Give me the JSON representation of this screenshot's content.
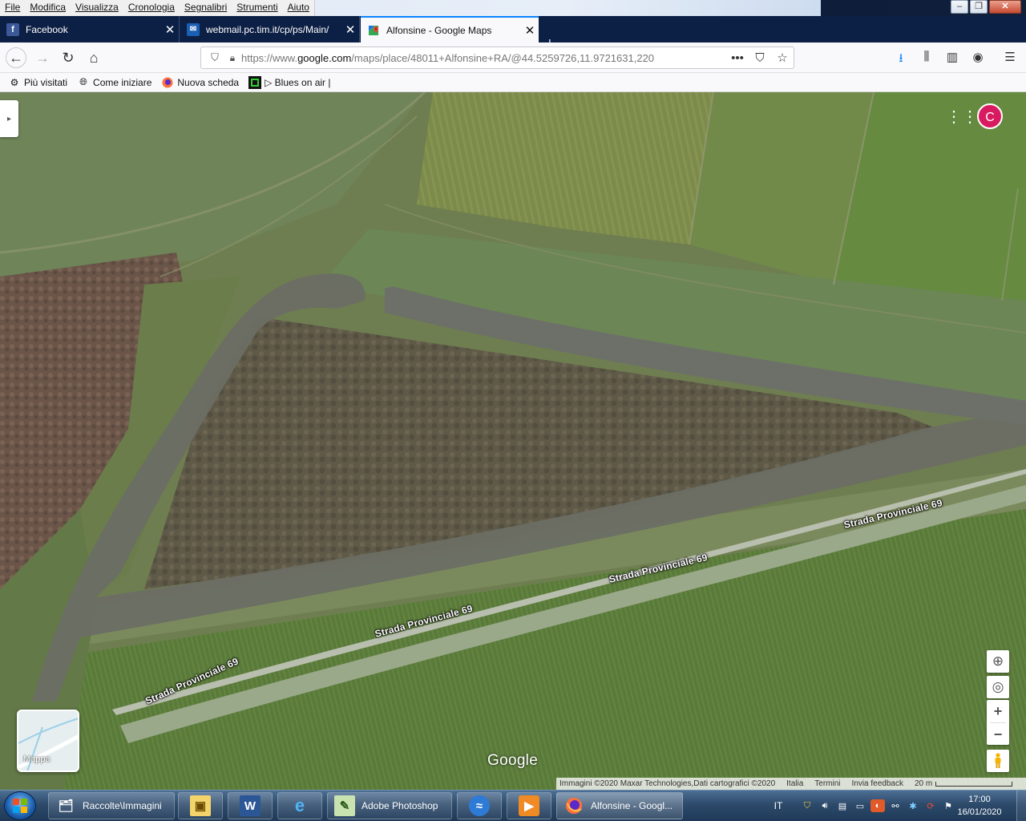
{
  "menubar": {
    "items": [
      "File",
      "Modifica",
      "Visualizza",
      "Cronologia",
      "Segnalibri",
      "Strumenti",
      "Aiuto"
    ]
  },
  "tabs": [
    {
      "label": "Facebook",
      "favicon": "facebook-icon",
      "active": false
    },
    {
      "label": "webmail.pc.tim.it/cp/ps/Main/",
      "favicon": "mail-icon",
      "active": false
    },
    {
      "label": "Alfonsine - Google Maps",
      "favicon": "google-maps-icon",
      "active": true
    }
  ],
  "navbar": {
    "url_prefix": "https://www.",
    "url_domain": "google.com",
    "url_rest": "/maps/place/48011+Alfonsine+RA/@44.5259726,11.9721631,220"
  },
  "bookmarks": [
    {
      "label": "Più visitati",
      "icon": "gear-icon"
    },
    {
      "label": "Come iniziare",
      "icon": "globe-icon"
    },
    {
      "label": "Nuova scheda",
      "icon": "firefox-icon"
    },
    {
      "label": "▷ Blues on air |",
      "icon": "blues-on-air-icon"
    }
  ],
  "map": {
    "account_initial": "C",
    "road_labels": [
      "Strada Provinciale 69",
      "Strada Provinciale 69",
      "Strada Provinciale 69",
      "Strada Provinciale 69"
    ],
    "minimap_label": "Mappa",
    "logo": "Google",
    "attribution": "Immagini ©2020 Maxar Technologies,Dati cartografici ©2020",
    "links": [
      "Italia",
      "Termini",
      "Invia feedback"
    ],
    "scale": "20 m"
  },
  "taskbar": {
    "buttons": [
      {
        "label": "Raccolte\\Immagini",
        "icon": "folder-icon"
      },
      {
        "label": "Adobe Photoshop",
        "icon": "photoshop-icon"
      },
      {
        "label": "Alfonsine - Googl...",
        "icon": "firefox-icon"
      }
    ],
    "lang": "IT",
    "time": "17:00",
    "date": "16/01/2020"
  },
  "colors": {
    "tab_accent": "#0a84ff",
    "tabstrip_bg": "#0c1f44",
    "avatar": "#d81b60"
  }
}
